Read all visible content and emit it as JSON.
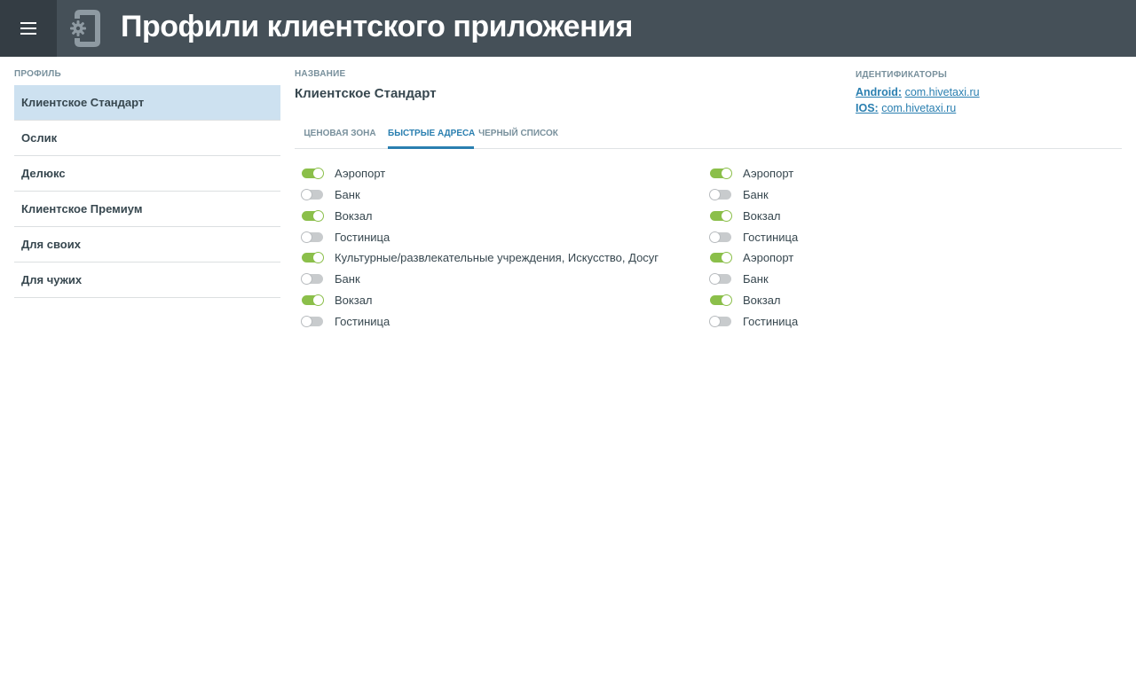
{
  "header": {
    "title": "Профили клиентского приложения",
    "menu_icon": "hamburger-menu-icon",
    "app_icon": "mobile-settings-icon",
    "bg_color": "#455058"
  },
  "sidebar": {
    "label": "Профиль",
    "items": [
      {
        "label": "Клиентское Стандарт",
        "active": true
      },
      {
        "label": "Ослик"
      },
      {
        "label": "Делюкс"
      },
      {
        "label": "Клиентское Премиум"
      },
      {
        "label": "Для своих"
      },
      {
        "label": "Для чужих"
      }
    ]
  },
  "main": {
    "name_label": "Название",
    "name_value": "Клиентское Стандарт",
    "identifiers": {
      "label": "Идентификаторы",
      "android_key": "Android:",
      "android_value": "com.hivetaxi.ru",
      "ios_key": "IOS:",
      "ios_value": "com.hivetaxi.ru"
    },
    "tabs": [
      {
        "label": "Ценовая зона"
      },
      {
        "label": "Быстрые адреса",
        "active": true
      },
      {
        "label": "Черный список"
      }
    ],
    "toggles_left": [
      {
        "label": "Аэропорт",
        "on": true
      },
      {
        "label": "Банк",
        "on": false
      },
      {
        "label": "Вокзал",
        "on": true
      },
      {
        "label": "Гостиница",
        "on": false
      },
      {
        "label": "Культурные/развлекательные учреждения, Искусство, Досуг",
        "on": true
      },
      {
        "label": "Банк",
        "on": false
      },
      {
        "label": "Вокзал",
        "on": true
      },
      {
        "label": "Гостиница",
        "on": false
      }
    ],
    "toggles_right": [
      {
        "label": "Аэропорт",
        "on": true
      },
      {
        "label": "Банк",
        "on": false
      },
      {
        "label": "Вокзал",
        "on": true
      },
      {
        "label": "Гостиница",
        "on": false
      },
      {
        "label": "Аэропорт",
        "on": true
      },
      {
        "label": "Банк",
        "on": false
      },
      {
        "label": "Вокзал",
        "on": true
      },
      {
        "label": "Гостиница",
        "on": false
      }
    ]
  },
  "colors": {
    "accent": "#2a7fb0",
    "toggle_on": "#8bbf4a",
    "toggle_off": "#c8cbcd",
    "active_row": "#cde1f0"
  }
}
